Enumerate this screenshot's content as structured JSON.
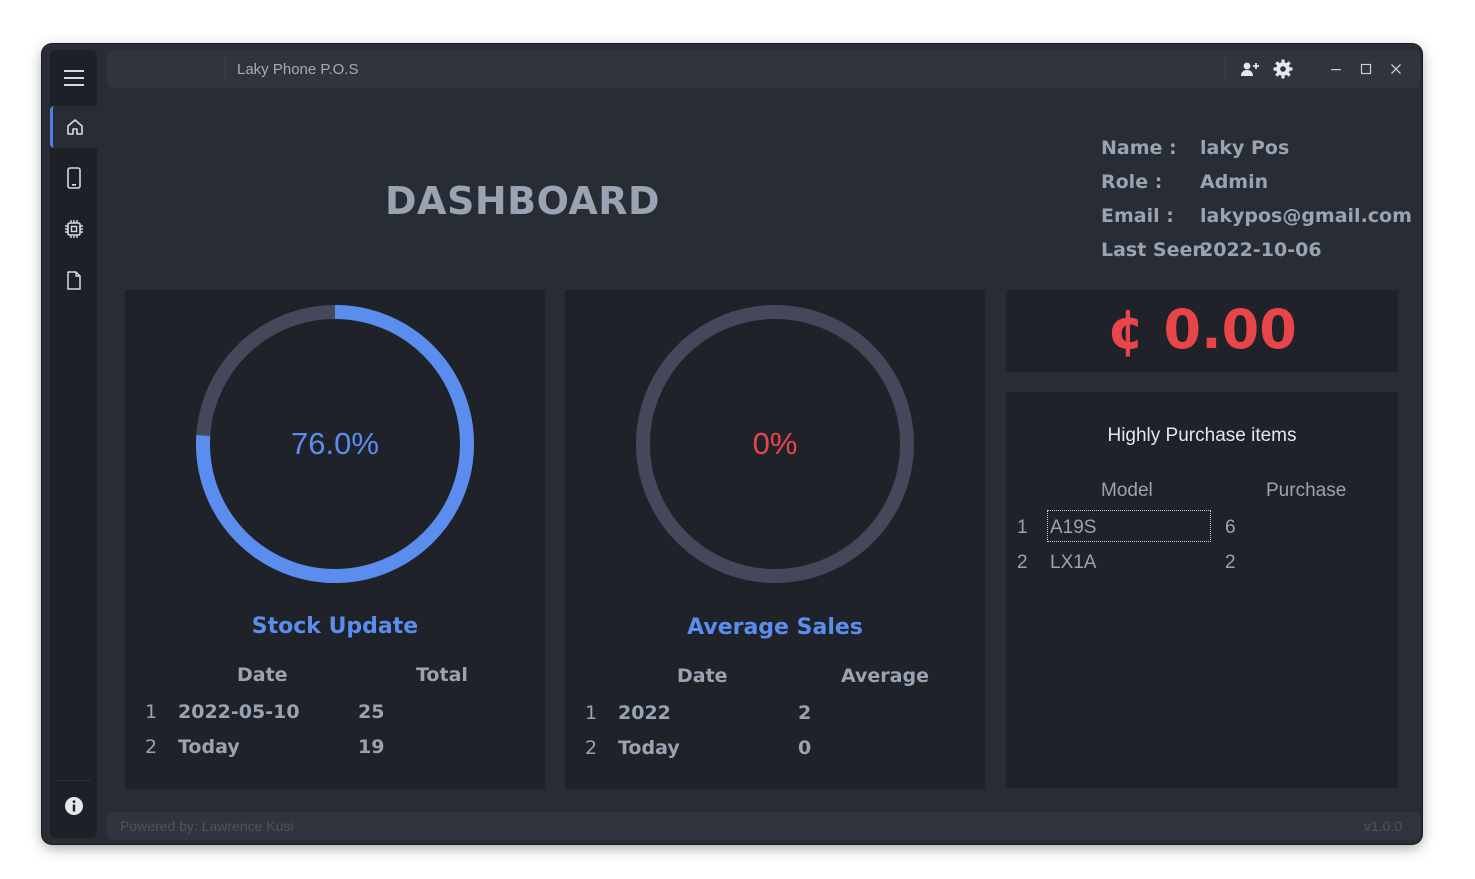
{
  "app": {
    "title": "Laky Phone P.O.S"
  },
  "sidebar": {
    "items": [
      {
        "icon": "menu-icon"
      },
      {
        "icon": "home-icon",
        "active": true
      },
      {
        "icon": "phone-icon"
      },
      {
        "icon": "chip-icon"
      },
      {
        "icon": "document-icon"
      },
      {
        "icon": "info-icon"
      }
    ]
  },
  "toolbar": {
    "icons": [
      "add-user-icon",
      "gear-icon"
    ],
    "window_controls": [
      "minimize-icon",
      "maximize-icon",
      "close-icon"
    ]
  },
  "header": {
    "title": "DASHBOARD"
  },
  "user": {
    "name_label": "Name :",
    "name_value": "laky Pos",
    "role_label": "Role :",
    "role_value": "Admin",
    "email_label": "Email :",
    "email_value": "lakypos@gmail.com",
    "last_seen_label": "Last Seen",
    "last_seen_value": "2022-10-06"
  },
  "stock": {
    "gauge_text": "76.0%",
    "gauge_fraction": 0.76,
    "title": "Stock Update",
    "columns": [
      "Date",
      "Total"
    ],
    "rows": [
      {
        "n": "1",
        "date": "2022-05-10",
        "total": "25"
      },
      {
        "n": "2",
        "date": "Today",
        "total": "19"
      }
    ]
  },
  "sales": {
    "gauge_text": "0%",
    "gauge_fraction": 0,
    "title": "Average Sales",
    "columns": [
      "Date",
      "Average"
    ],
    "rows": [
      {
        "n": "1",
        "date": "2022",
        "average": "2"
      },
      {
        "n": "2",
        "date": "Today",
        "average": "0"
      }
    ]
  },
  "balance": {
    "amount": "¢ 0.00"
  },
  "purchases": {
    "title": "Highly Purchase items",
    "columns": [
      "Model",
      "Purchase"
    ],
    "rows": [
      {
        "n": "1",
        "model": "A19S",
        "purchase": "6"
      },
      {
        "n": "2",
        "model": "LX1A",
        "purchase": "2"
      }
    ]
  },
  "footer": {
    "credit": "Powered by: Lawrence Kusi",
    "version": "v1.0.0"
  },
  "colors": {
    "accent": "#5b8def",
    "danger": "#e8454a",
    "track": "#45475a"
  }
}
